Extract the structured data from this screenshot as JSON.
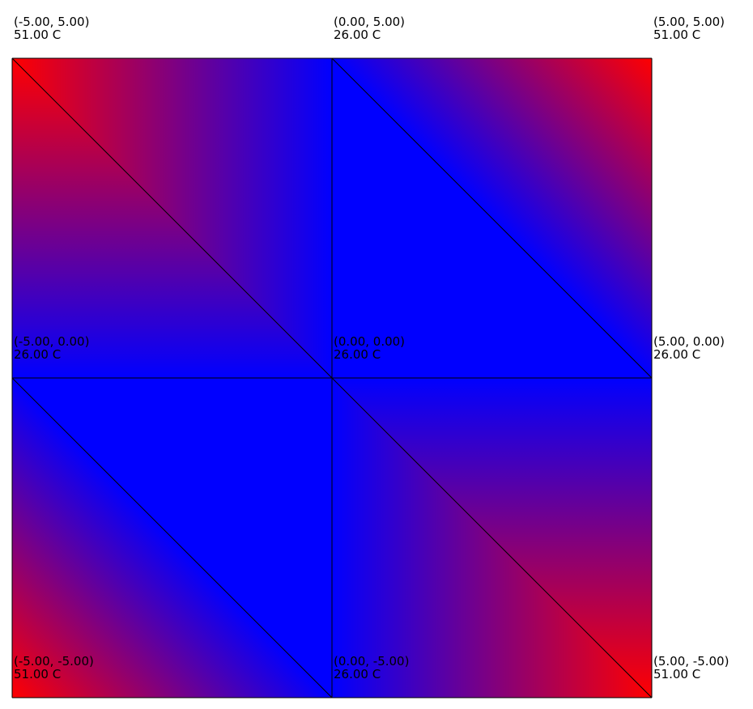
{
  "grid": {
    "nodes": [
      {
        "row": 0,
        "col": 0,
        "coord": "(-5.00, 5.00)",
        "temp_label": "51.00 C",
        "temp": 51.0
      },
      {
        "row": 0,
        "col": 1,
        "coord": "(0.00, 5.00)",
        "temp_label": "26.00 C",
        "temp": 26.0
      },
      {
        "row": 0,
        "col": 2,
        "coord": "(5.00, 5.00)",
        "temp_label": "51.00 C",
        "temp": 51.0
      },
      {
        "row": 1,
        "col": 0,
        "coord": "(-5.00, 0.00)",
        "temp_label": "26.00 C",
        "temp": 26.0
      },
      {
        "row": 1,
        "col": 1,
        "coord": "(0.00, 0.00)",
        "temp_label": "26.00 C",
        "temp": 26.0
      },
      {
        "row": 1,
        "col": 2,
        "coord": "(5.00, 0.00)",
        "temp_label": "26.00 C",
        "temp": 26.0
      },
      {
        "row": 2,
        "col": 0,
        "coord": "(-5.00, -5.00)",
        "temp_label": "51.00 C",
        "temp": 51.0
      },
      {
        "row": 2,
        "col": 1,
        "coord": "(0.00, -5.00)",
        "temp_label": "26.00 C",
        "temp": 26.0
      },
      {
        "row": 2,
        "col": 2,
        "coord": "(5.00, -5.00)",
        "temp_label": "51.00 C",
        "temp": 51.0
      }
    ]
  },
  "colors": {
    "cold": "#0000ff",
    "hot": "#ff0000",
    "edge": "#000000"
  }
}
